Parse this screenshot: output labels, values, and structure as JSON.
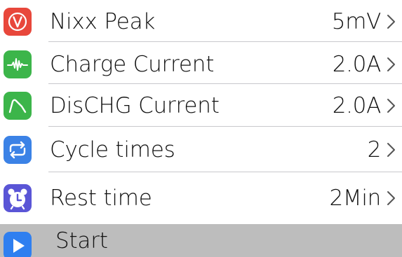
{
  "rows": [
    {
      "label": "Nixx Peak",
      "value": "5mV",
      "icon": "v-circle-icon",
      "color": "#e8473b"
    },
    {
      "label": "Charge Current",
      "value": "2.0A",
      "icon": "pulse-wave-icon",
      "color": "#3cb54a"
    },
    {
      "label": "DisCHG Current",
      "value": "2.0A",
      "icon": "discharge-curve-icon",
      "color": "#3cb54a"
    },
    {
      "label": "Cycle times",
      "value": "2",
      "icon": "repeat-icon",
      "color": "#3b82e6"
    },
    {
      "label": "Rest time",
      "value": "2Min",
      "icon": "alarm-clock-icon",
      "color": "#5a55d6"
    },
    {
      "label": "Start",
      "icon": "play-icon",
      "color": "#2f7ff0"
    }
  ]
}
